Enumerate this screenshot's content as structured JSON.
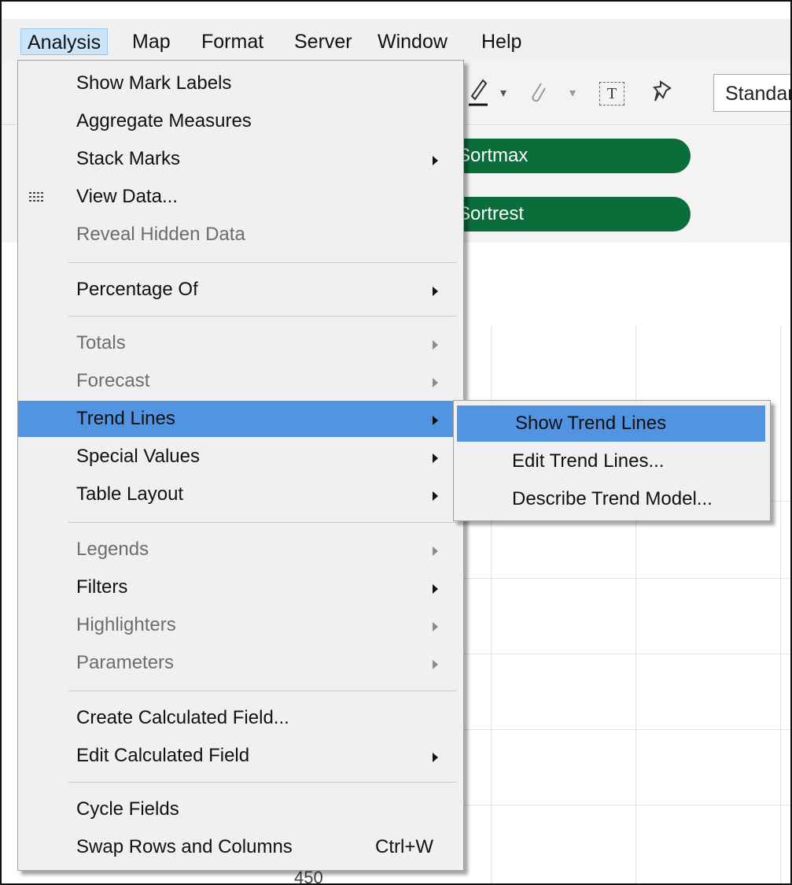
{
  "menubar": {
    "items": [
      {
        "label": "Analysis"
      },
      {
        "label": "Map"
      },
      {
        "label": "Format"
      },
      {
        "label": "Server"
      },
      {
        "label": "Window"
      },
      {
        "label": "Help"
      }
    ]
  },
  "toolbar": {
    "fit_dropdown_value": "Standard",
    "text_tool_glyph": "T"
  },
  "shelves": {
    "columns_pill": "Sortmax",
    "rows_pill": "Sortrest"
  },
  "canvas": {
    "axis_tick": "450"
  },
  "analysis_menu": {
    "items": [
      {
        "label": "Show Mark Labels",
        "enabled": true
      },
      {
        "label": "Aggregate Measures",
        "enabled": true
      },
      {
        "label": "Stack Marks",
        "enabled": true,
        "submenu": true
      },
      {
        "label": "View Data...",
        "enabled": true,
        "icon": "view-data-grid-icon"
      },
      {
        "label": "Reveal Hidden Data",
        "enabled": false
      },
      {
        "label": "Percentage Of",
        "enabled": true,
        "submenu": true
      },
      {
        "label": "Totals",
        "enabled": false,
        "submenu": true
      },
      {
        "label": "Forecast",
        "enabled": false,
        "submenu": true
      },
      {
        "label": "Trend Lines",
        "enabled": true,
        "submenu": true,
        "highlighted": true
      },
      {
        "label": "Special Values",
        "enabled": true,
        "submenu": true
      },
      {
        "label": "Table Layout",
        "enabled": true,
        "submenu": true
      },
      {
        "label": "Legends",
        "enabled": false,
        "submenu": true
      },
      {
        "label": "Filters",
        "enabled": true,
        "submenu": true
      },
      {
        "label": "Highlighters",
        "enabled": false,
        "submenu": true
      },
      {
        "label": "Parameters",
        "enabled": false,
        "submenu": true
      },
      {
        "label": "Create Calculated Field...",
        "enabled": true
      },
      {
        "label": "Edit Calculated Field",
        "enabled": true,
        "submenu": true
      },
      {
        "label": "Cycle Fields",
        "enabled": true
      },
      {
        "label": "Swap Rows and Columns",
        "enabled": true,
        "shortcut": "Ctrl+W"
      }
    ]
  },
  "trend_lines_submenu": {
    "items": [
      {
        "label": "Show Trend Lines",
        "highlighted": true
      },
      {
        "label": "Edit Trend Lines..."
      },
      {
        "label": "Describe Trend Model..."
      }
    ]
  },
  "colors": {
    "highlight": "#5294e2",
    "pill_green": "#0b6e3a",
    "menu_bg": "#f0f0f0",
    "disabled_text": "#6d6d6d"
  }
}
